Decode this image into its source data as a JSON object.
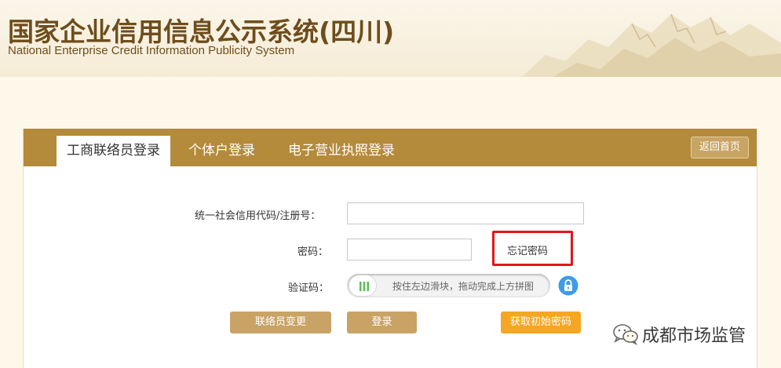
{
  "header": {
    "title": "国家企业信用信息公示系统(四川)",
    "subtitle": "National Enterprise Credit Information Publicity System"
  },
  "tabs": [
    {
      "label": "工商联络员登录",
      "active": true
    },
    {
      "label": "个体户登录",
      "active": false
    },
    {
      "label": "电子营业执照登录",
      "active": false
    }
  ],
  "back_button": "返回首页",
  "form": {
    "credit_code_label": "统一社会信用代码/注册号：",
    "credit_code_value": "",
    "password_label": "密码：",
    "password_value": "",
    "forgot_password": "忘记密码",
    "captcha_label": "验证码：",
    "slider_hint": "按住左边滑块，拖动完成上方拼图",
    "slider_progress": 0
  },
  "buttons": {
    "contact_change": "联络员变更",
    "login": "登录",
    "get_initial_password": "获取初始密码"
  },
  "watermark": {
    "text": "成都市场监管",
    "icon": "wechat-icon"
  },
  "colors": {
    "tab_bar": "#b48a3b",
    "brand_text": "#6e4d1c",
    "highlight_red": "#e3161c",
    "button_gold": "#c9a366",
    "button_orange": "#f5a623",
    "lock_blue": "#3d9be9"
  }
}
